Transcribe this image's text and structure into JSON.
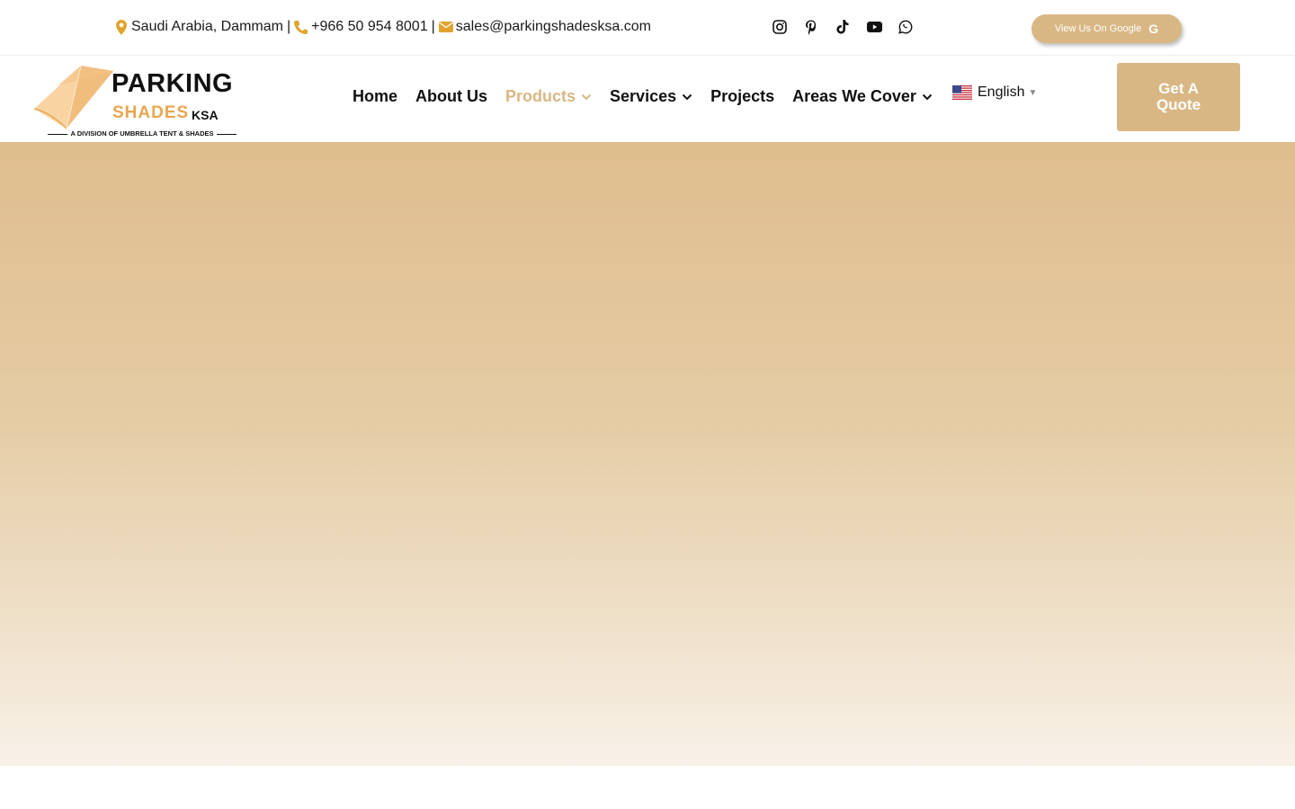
{
  "topbar": {
    "location": "Saudi Arabia, Dammam",
    "phone": "+966 50 954 8001",
    "email": "sales@parkingshadesksa.com",
    "separator": "|",
    "socials": [
      "instagram-icon",
      "pinterest-icon",
      "tiktok-icon",
      "youtube-icon",
      "whatsapp-icon"
    ],
    "google_button": "View Us On Google",
    "google_glyph": "G"
  },
  "logo": {
    "line1": "PARKING",
    "line2": "SHADES",
    "line3": "KSA",
    "tagline": "A DIVISION OF UMBRELLA TENT & SHADES"
  },
  "nav": {
    "items": [
      {
        "label": "Home",
        "dropdown": false
      },
      {
        "label": "About Us",
        "dropdown": false
      },
      {
        "label": "Products",
        "dropdown": true,
        "active": true
      },
      {
        "label": "Services",
        "dropdown": true
      },
      {
        "label": "Projects",
        "dropdown": false
      },
      {
        "label": "Areas We Cover",
        "dropdown": true
      }
    ]
  },
  "language": {
    "selected": "English",
    "arrow": "▼"
  },
  "quote_button": "Get A Quote",
  "colors": {
    "accent": "#d9b784",
    "icon_gold": "#e0a42e",
    "active_nav": "#d9b784",
    "logo_orange": "#e9a64f"
  }
}
